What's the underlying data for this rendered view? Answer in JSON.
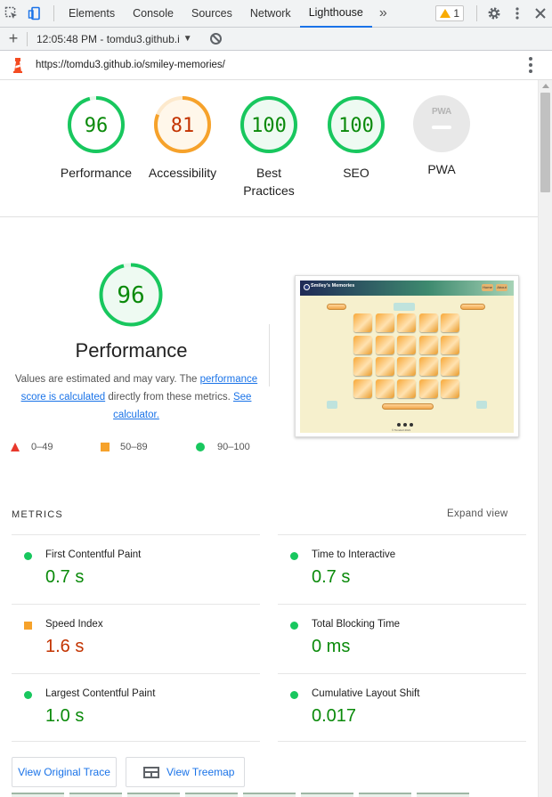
{
  "devtools": {
    "tabs": [
      {
        "label": "Elements"
      },
      {
        "label": "Console"
      },
      {
        "label": "Sources"
      },
      {
        "label": "Network"
      },
      {
        "label": "Lighthouse"
      }
    ],
    "more_tabs": "»",
    "warning_count": "1"
  },
  "report_toolbar": {
    "new_report": "+",
    "selected_report": "12:05:48 PM - tomdu3.github.i"
  },
  "url_bar": {
    "url": "https://tomdu3.github.io/smiley-memories/"
  },
  "gauges": [
    {
      "score": "96",
      "label": "Performance",
      "rating": "pass",
      "fraction": 0.96
    },
    {
      "score": "81",
      "label": "Accessibility",
      "rating": "average",
      "fraction": 0.81
    },
    {
      "score": "100",
      "label_line1": "Best",
      "label_line2": "Practices",
      "rating": "pass",
      "fraction": 1.0
    },
    {
      "score": "100",
      "label": "SEO",
      "rating": "pass",
      "fraction": 1.0
    }
  ],
  "pwa": {
    "badge_text": "PWA",
    "label": "PWA"
  },
  "performance": {
    "score": "96",
    "fraction": 0.96,
    "title": "Performance",
    "desc_prefix": "Values are estimated and may vary. The ",
    "desc_link1": "performance score is calculated",
    "desc_middle": " directly from these metrics. ",
    "desc_link2": "See calculator."
  },
  "legend": [
    {
      "range": "0–49",
      "color": "#e8382c"
    },
    {
      "range": "50–89",
      "color": "#f6a22b"
    },
    {
      "range": "90–100",
      "color": "#18c75e"
    }
  ],
  "screenshot_thumb": {
    "title": "Smiley's Memories",
    "nav_btn1": "Home",
    "nav_btn2": "About",
    "footer": "© Tomdu3 2021"
  },
  "metrics": {
    "header": "METRICS",
    "expand": "Expand view",
    "items": [
      {
        "name": "First Contentful Paint",
        "value": "0.7 s",
        "rating": "pass"
      },
      {
        "name": "Time to Interactive",
        "value": "0.7 s",
        "rating": "pass"
      },
      {
        "name": "Speed Index",
        "value": "1.6 s",
        "rating": "average"
      },
      {
        "name": "Total Blocking Time",
        "value": "0 ms",
        "rating": "pass"
      },
      {
        "name": "Largest Contentful Paint",
        "value": "1.0 s",
        "rating": "pass"
      },
      {
        "name": "Cumulative Layout Shift",
        "value": "0.017",
        "rating": "pass"
      }
    ]
  },
  "buttons": {
    "view_trace": "View Original Trace",
    "view_treemap": "View Treemap"
  },
  "colors": {
    "pass": "#0a8a0a",
    "pass_ring": "#18c75e",
    "average": "#c33300",
    "average_ring": "#f6a22b",
    "accent": "#1a73e8"
  }
}
